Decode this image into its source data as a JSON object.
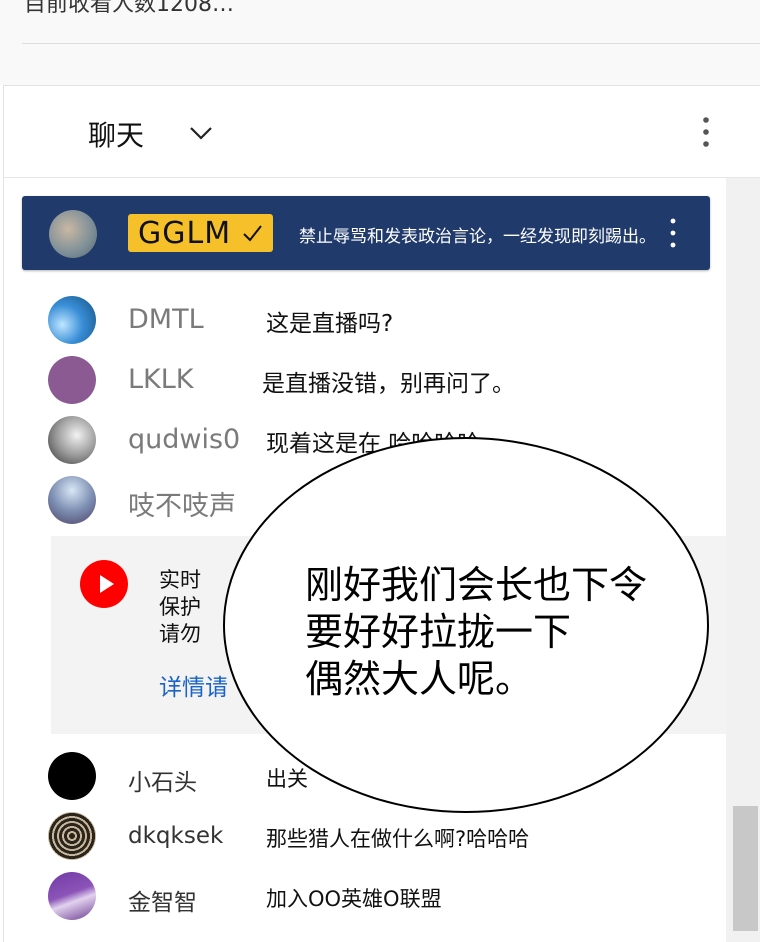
{
  "top": {
    "viewer_count": "目前收看人数1208…"
  },
  "chat_header": {
    "title": "聊天"
  },
  "pinned": {
    "author": "GGLM",
    "message": "禁止辱骂和发表政治言论，一经发现即刻踢出。"
  },
  "messages": [
    {
      "author": "DMTL",
      "text": "这是直播吗?"
    },
    {
      "author": "LKLK",
      "text": "是直播没错，别再问了。"
    },
    {
      "author": "qudwis0",
      "text": "现着这是在 哈哈哈哈"
    },
    {
      "author": "吱不吱声",
      "text": ""
    },
    {
      "author": "小石头",
      "text": "出关"
    },
    {
      "author": "dkqksek",
      "text": "那些猎人在做什么啊?哈哈哈"
    },
    {
      "author": "金智智",
      "text": "加入OO英雄O联盟"
    }
  ],
  "notice": {
    "line1": "实时",
    "line2": "保护",
    "line3": "请勿",
    "link": "详情请"
  },
  "speech_bubble": {
    "line1": "刚好我们会长也下令",
    "line2": "要好好拉拢一下",
    "line3": "偶然大人呢。"
  },
  "colors": {
    "pinned_bg": "#1f3a6b",
    "badge": "#f6c02a",
    "link": "#1a63c7",
    "youtube_red": "#ff0000"
  }
}
